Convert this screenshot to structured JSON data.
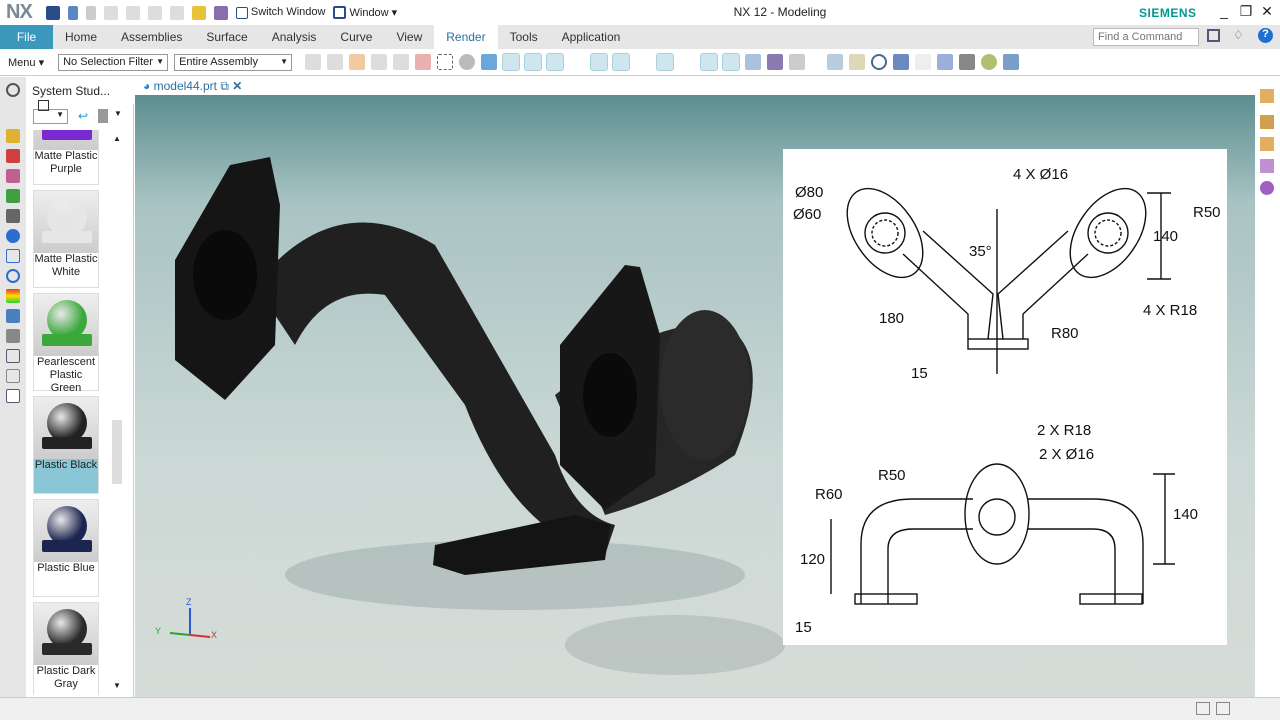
{
  "app": {
    "logo": "NX",
    "title": "NX 12 - Modeling",
    "brand": "SIEMENS"
  },
  "quick_access": {
    "switch_window": "Switch Window",
    "window": "Window ▾"
  },
  "ribbon": {
    "tabs": [
      "File",
      "Home",
      "Assemblies",
      "Surface",
      "Analysis",
      "Curve",
      "View",
      "Render",
      "Tools",
      "Application"
    ],
    "active": "Render",
    "find_placeholder": "Find a Command"
  },
  "toolbar": {
    "menu": "Menu ▾",
    "selection_filter": "No Selection Filter",
    "scope": "Entire Assembly"
  },
  "panel": {
    "title": "System Stud...",
    "materials": [
      {
        "name": "Matte Plastic Purple",
        "color": "#7a2ad0"
      },
      {
        "name": "Matte Plastic White",
        "color": "#e6e6e6"
      },
      {
        "name": "Pearlescent Plastic Green",
        "color": "#3aa83a"
      },
      {
        "name": "Plastic Black",
        "color": "#222222",
        "selected": true
      },
      {
        "name": "Plastic Blue",
        "color": "#1c2450"
      },
      {
        "name": "Plastic Dark Gray",
        "color": "#2a2a2a"
      }
    ]
  },
  "document": {
    "tab": "model44.prt"
  },
  "triad": {
    "x": "X",
    "y": "Y",
    "z": "Z"
  },
  "drawing": {
    "labels": {
      "d80": "Ø80",
      "d60": "Ø60",
      "holes16": "4 X Ø16",
      "r50": "R50",
      "dim140": "140",
      "ang35": "35°",
      "dim180": "180",
      "r80": "R80",
      "r18": "4 X R18",
      "dim15": "15",
      "b_r18": "2 X R18",
      "b_d16": "2 X Ø16",
      "b_r50": "R50",
      "b_r60": "R60",
      "b_140": "140",
      "b_120": "120",
      "b_15": "15"
    }
  }
}
